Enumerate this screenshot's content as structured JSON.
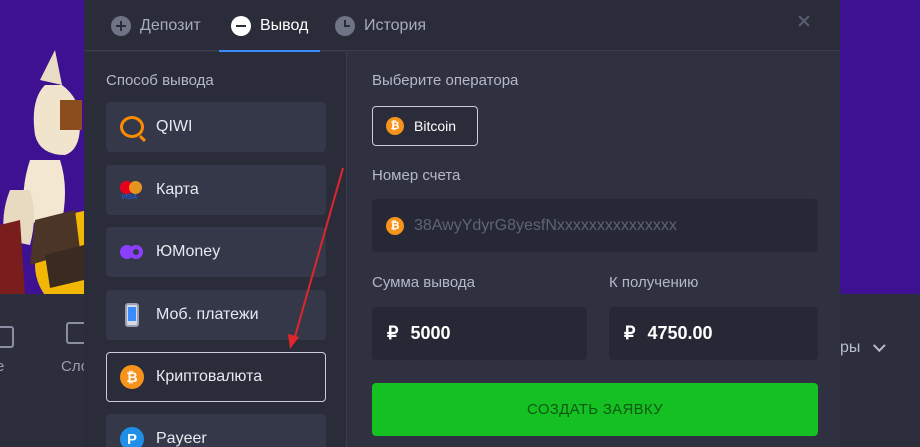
{
  "tabs": [
    {
      "label": "Депозит",
      "icon": "plus-circle-icon"
    },
    {
      "label": "Вывод",
      "icon": "minus-circle-icon",
      "active": true
    },
    {
      "label": "История",
      "icon": "clock-icon"
    }
  ],
  "left": {
    "section_label": "Способ вывода",
    "methods": [
      {
        "label": "QIWI",
        "icon": "qiwi-icon"
      },
      {
        "label": "Карта",
        "icon": "card-icon"
      },
      {
        "label": "ЮMoney",
        "icon": "yoomoney-icon"
      },
      {
        "label": "Моб. платежи",
        "icon": "mobile-icon"
      },
      {
        "label": "Криптовалюта",
        "icon": "bitcoin-icon",
        "selected": true
      },
      {
        "label": "Payeer",
        "icon": "payeer-icon"
      }
    ]
  },
  "right": {
    "operator_label": "Выберите оператора",
    "operator_value": "Bitcoin",
    "account_label": "Номер счета",
    "account_placeholder": "38AwyYdyrG8yesfNxxxxxxxxxxxxxxx",
    "sum_label": "Сумма вывода",
    "sum_currency": "₽",
    "sum_value": "5000",
    "receive_label": "К получению",
    "receive_currency": "₽",
    "receive_value": "4750.00",
    "submit_label": "СОЗДАТЬ ЗАЯВКУ"
  },
  "background": {
    "nav_left_1": "е",
    "nav_left_2": "Сло",
    "nav_right": "ры"
  },
  "colors": {
    "accent_blue": "#3a8bff",
    "submit_green": "#15c022",
    "bitcoin_orange": "#f7931a",
    "annotation_arrow": "#e0262a"
  }
}
